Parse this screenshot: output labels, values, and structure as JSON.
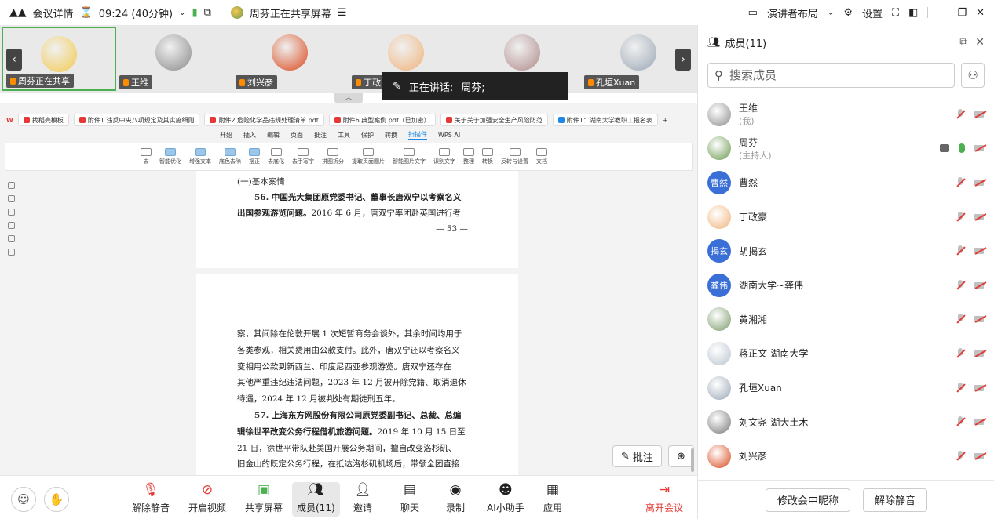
{
  "topbar": {
    "meeting_details": "会议详情",
    "time": "09:24 (40分钟)",
    "sharing": "周芬正在共享屏幕",
    "layout": "演讲者布局",
    "settings": "设置"
  },
  "thumbnails": [
    {
      "name": "周芬正在共享",
      "color": "#f2c94c"
    },
    {
      "name": "王维",
      "color": "#8a8a8a"
    },
    {
      "name": "刘兴彦",
      "color": "#d9481c"
    },
    {
      "name": "丁政",
      "color": "#f0b27a"
    },
    {
      "name": "",
      "color": "#b08a8a"
    },
    {
      "name": "孔垣Xuan",
      "color": "#9aa7b5"
    }
  ],
  "speaking": {
    "label": "正在讲话:",
    "name": "周芬;"
  },
  "wps": {
    "tabs": [
      "找稻壳模板",
      "附件1 违反中央八项规定及其实施细则",
      "附件2 危险化学品违规处理清单.pdf",
      "附件6 典型案例.pdf（已加密）",
      "关于关于加强安全生产风险防范",
      "附件1：湖南大学教职工报名表"
    ],
    "menu": [
      "开始",
      "插入",
      "编辑",
      "页面",
      "批注",
      "工具",
      "保护",
      "转换",
      "扫描件",
      "WPS AI"
    ],
    "active_menu": "扫描件",
    "ribbon": [
      "去",
      "智能优化",
      "增强文本",
      "底色去除",
      "摆正",
      "去底化",
      "去手写字",
      "拼图拆分",
      "提取页面图片",
      "智能图片文字",
      "识别文字",
      "整理",
      "转换",
      "反转与设置",
      "文档"
    ]
  },
  "doc": {
    "p1_l1": "(一)基本案情",
    "p1_l2_bold": "56. 中国光大集团原党委书记、董事长唐双宁以考察名义",
    "p1_l3_bold": "出国参观游览问题。",
    "p1_l3_rest": "2016 年 6 月，唐双宁率团赴英国进行考",
    "p1_pnum": "— 53 —",
    "p2_lines": [
      "察，其间除在伦敦开展 1 次短暂商务会谈外，其余时间均用于",
      "各类参观，相关费用由公款支付。此外，唐双宁还以考察名义",
      "变相用公款到新西兰、印度尼西亚参观游览。唐双宁还存在",
      "其他严重违纪违法问题，2023 年 12 月被开除党籍、取消退休",
      "待遇，2024 年 12 月被判处有期徒刑五年。"
    ],
    "p2_bold1": "57. 上海东方网股份有限公司原党委副书记、总裁、总编",
    "p2_bold2": "辑徐世平改变公务行程借机旅游问题。",
    "p2_rest2": "2019 年 10 月 15 日至",
    "p2_tail": [
      "21 日，徐世平带队赴美国开展公务期间，擅自改变洛杉矶、",
      "旧金山的既定公务行程，在抵达洛杉矶机场后，带领全团直接"
    ]
  },
  "annotate": {
    "label": "批注"
  },
  "bottom": {
    "unmute": "解除静音",
    "video": "开启视频",
    "share": "共享屏幕",
    "members": "成员(11)",
    "invite": "邀请",
    "chat": "聊天",
    "record": "录制",
    "ai": "AI小助手",
    "apps": "应用",
    "leave": "离开会议"
  },
  "panel": {
    "title": "成员(11)",
    "search_placeholder": "搜索成员",
    "members": [
      {
        "name": "王维",
        "sub": "(我)",
        "color": "#8a8a8a",
        "initials": "",
        "host": false
      },
      {
        "name": "周芬",
        "sub": "(主持人)",
        "color": "#6a994e",
        "initials": "",
        "host": true
      },
      {
        "name": "曹然",
        "sub": "",
        "color": "#3b6fd8",
        "initials": "曹然",
        "host": false
      },
      {
        "name": "丁政豪",
        "sub": "",
        "color": "#f0b27a",
        "initials": "",
        "host": false
      },
      {
        "name": "胡揭玄",
        "sub": "",
        "color": "#3b6fd8",
        "initials": "揭玄",
        "host": false
      },
      {
        "name": "湖南大学~龚伟",
        "sub": "",
        "color": "#3b6fd8",
        "initials": "龚伟",
        "host": false
      },
      {
        "name": "黄湘湘",
        "sub": "",
        "color": "#7a9a6a",
        "initials": "",
        "host": false
      },
      {
        "name": "蒋正文-湖南大学",
        "sub": "",
        "color": "#b9c4cf",
        "initials": "",
        "host": false
      },
      {
        "name": "孔垣Xuan",
        "sub": "",
        "color": "#9aa7b5",
        "initials": "",
        "host": false
      },
      {
        "name": "刘文尧-湖大土木",
        "sub": "",
        "color": "#777777",
        "initials": "",
        "host": false
      },
      {
        "name": "刘兴彦",
        "sub": "",
        "color": "#d9481c",
        "initials": "",
        "host": false
      }
    ],
    "rename_btn": "修改会中昵称",
    "unmute_all_btn": "解除静音"
  }
}
